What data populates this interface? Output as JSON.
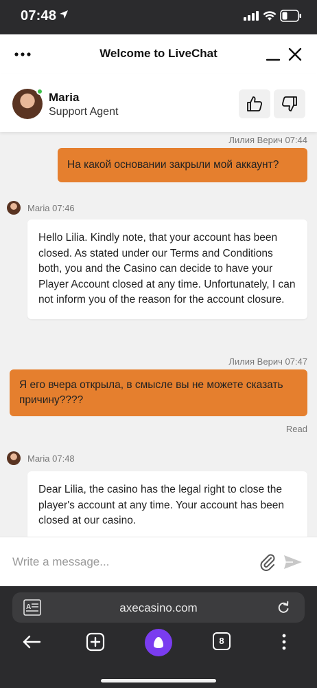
{
  "status_bar": {
    "time": "07:48"
  },
  "chat_header": {
    "title": "Welcome to LiveChat"
  },
  "agent": {
    "name": "Maria",
    "role": "Support Agent"
  },
  "messages": [
    {
      "sender": "Лилия Верич",
      "time": "07:44",
      "meta": "Лилия Верич 07:44",
      "direction": "out",
      "text": "На какой основании закрыли мой аккаунт?"
    },
    {
      "sender": "Maria",
      "time": "07:46",
      "meta": "Maria 07:46",
      "direction": "in",
      "text": "Hello Lilia. Kindly note, that your account has been closed. As stated under our Terms and Conditions both, you and the Casino can decide to have your Player Account closed at any time. Unfortunately, I can not inform you of the reason for the account closure."
    },
    {
      "sender": "Лилия Верич",
      "time": "07:47",
      "meta": "Лилия Верич 07:47",
      "direction": "out",
      "text": "Я его вчера открыла, в смысле вы не можете сказать причину????",
      "status": "Read"
    },
    {
      "sender": "Maria",
      "time": "07:48",
      "meta": "Maria 07:48",
      "direction": "in",
      "text": "Dear Lilia, the casino has the legal right to close the player's account at any time. Your account has been closed at our casino."
    }
  ],
  "composer": {
    "placeholder": "Write a message..."
  },
  "browser": {
    "url": "axecasino.com",
    "tab_count": "8"
  },
  "colors": {
    "outgoing_bubble": "#e57f2e",
    "online_dot": "#3cc14a",
    "alice_button": "#7a3cf0"
  }
}
